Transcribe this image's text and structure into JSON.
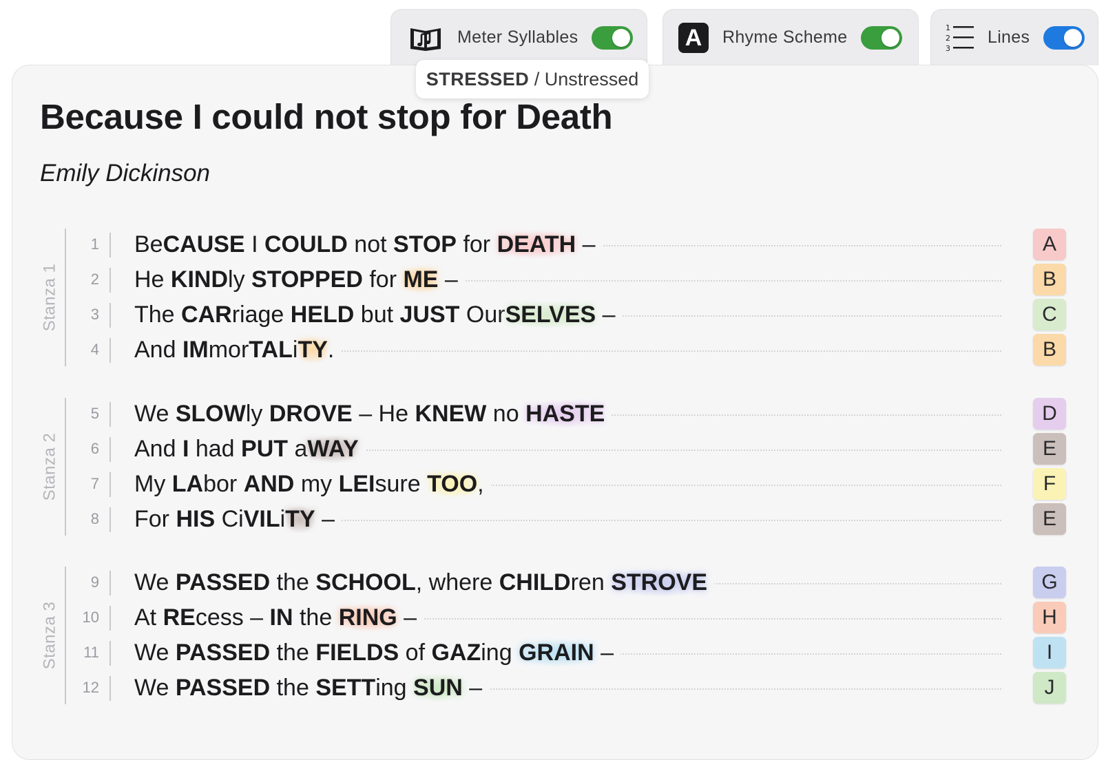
{
  "toolbar": {
    "meter": {
      "label": "Meter Syllables",
      "enabled": true,
      "toggle_color": "#3a9d3e",
      "icon": "music-book-icon"
    },
    "rhyme": {
      "label": "Rhyme Scheme",
      "enabled": true,
      "toggle_color": "#3a9d3e",
      "icon": "letter-a-icon",
      "icon_letter": "A"
    },
    "lines": {
      "label": "Lines",
      "enabled": true,
      "toggle_color": "#1f7ae0",
      "icon": "numbered-list-icon"
    }
  },
  "tooltip": {
    "stressed": "STRESSED",
    "separator": " / ",
    "unstressed": "Unstressed"
  },
  "poem": {
    "title": "Because I could not stop for Death",
    "author": "Emily Dickinson"
  },
  "rhyme_colors": {
    "A": "#f8c9c9",
    "B": "#fbd9a8",
    "C": "#d8ebcd",
    "D": "#e5cdee",
    "E": "#cbbfbb",
    "F": "#fbf3b5",
    "G": "#c9cdee",
    "H": "#f9cbb8",
    "I": "#bfe2f3",
    "J": "#cfe8c6"
  },
  "stanzas": [
    {
      "label": "Stanza 1",
      "lines": [
        {
          "num": "1",
          "rhyme": "A",
          "segments": [
            [
              "Be",
              0
            ],
            [
              "CAUSE",
              1
            ],
            [
              " I ",
              0
            ],
            [
              "COULD",
              1
            ],
            [
              " not ",
              0
            ],
            [
              "STOP",
              1
            ],
            [
              " for ",
              0
            ],
            [
              "DEATH",
              1
            ],
            [
              " –",
              0
            ]
          ]
        },
        {
          "num": "2",
          "rhyme": "B",
          "segments": [
            [
              "He ",
              0
            ],
            [
              "KIND",
              1
            ],
            [
              "ly ",
              0
            ],
            [
              "STOPPED",
              1
            ],
            [
              " for ",
              0
            ],
            [
              "ME",
              1
            ],
            [
              " –",
              0
            ]
          ]
        },
        {
          "num": "3",
          "rhyme": "C",
          "segments": [
            [
              "The ",
              0
            ],
            [
              "CAR",
              1
            ],
            [
              "riage ",
              0
            ],
            [
              "HELD",
              1
            ],
            [
              " but ",
              0
            ],
            [
              "JUST",
              1
            ],
            [
              " Our",
              0
            ],
            [
              "SELVES",
              1
            ],
            [
              " –",
              0
            ]
          ]
        },
        {
          "num": "4",
          "rhyme": "B",
          "segments": [
            [
              "And ",
              0
            ],
            [
              "IM",
              1
            ],
            [
              "mor",
              0
            ],
            [
              "TAL",
              1
            ],
            [
              "i",
              0
            ],
            [
              "TY",
              1
            ],
            [
              ".",
              0
            ]
          ]
        }
      ]
    },
    {
      "label": "Stanza 2",
      "lines": [
        {
          "num": "5",
          "rhyme": "D",
          "segments": [
            [
              "We ",
              0
            ],
            [
              "SLOW",
              1
            ],
            [
              "ly ",
              0
            ],
            [
              "DROVE",
              1
            ],
            [
              " – He ",
              0
            ],
            [
              "KNEW",
              1
            ],
            [
              " no ",
              0
            ],
            [
              "HASTE",
              1
            ]
          ]
        },
        {
          "num": "6",
          "rhyme": "E",
          "segments": [
            [
              "And ",
              0
            ],
            [
              "I",
              1
            ],
            [
              " had ",
              0
            ],
            [
              "PUT",
              1
            ],
            [
              " a",
              0
            ],
            [
              "WAY",
              1
            ]
          ]
        },
        {
          "num": "7",
          "rhyme": "F",
          "segments": [
            [
              "My ",
              0
            ],
            [
              "LA",
              1
            ],
            [
              "bor ",
              0
            ],
            [
              "AND",
              1
            ],
            [
              " my ",
              0
            ],
            [
              "LEI",
              1
            ],
            [
              "sure ",
              0
            ],
            [
              "TOO",
              1
            ],
            [
              ",",
              0
            ]
          ]
        },
        {
          "num": "8",
          "rhyme": "E",
          "segments": [
            [
              "For ",
              0
            ],
            [
              "HIS",
              1
            ],
            [
              " Ci",
              0
            ],
            [
              "VIL",
              1
            ],
            [
              "i",
              0
            ],
            [
              "TY",
              1
            ],
            [
              " –",
              0
            ]
          ]
        }
      ]
    },
    {
      "label": "Stanza 3",
      "lines": [
        {
          "num": "9",
          "rhyme": "G",
          "segments": [
            [
              "We ",
              0
            ],
            [
              "PASSED",
              1
            ],
            [
              " the ",
              0
            ],
            [
              "SCHOOL",
              1
            ],
            [
              ", where ",
              0
            ],
            [
              "CHILD",
              1
            ],
            [
              "ren ",
              0
            ],
            [
              "STROVE",
              1
            ]
          ]
        },
        {
          "num": "10",
          "rhyme": "H",
          "segments": [
            [
              "At ",
              0
            ],
            [
              "RE",
              1
            ],
            [
              "cess – ",
              0
            ],
            [
              "IN",
              1
            ],
            [
              " the ",
              0
            ],
            [
              "RING",
              1
            ],
            [
              " –",
              0
            ]
          ]
        },
        {
          "num": "11",
          "rhyme": "I",
          "segments": [
            [
              "We ",
              0
            ],
            [
              "PASSED",
              1
            ],
            [
              " the ",
              0
            ],
            [
              "FIELDS",
              1
            ],
            [
              " of ",
              0
            ],
            [
              "GAZ",
              1
            ],
            [
              "ing ",
              0
            ],
            [
              "GRAIN",
              1
            ],
            [
              " –",
              0
            ]
          ]
        },
        {
          "num": "12",
          "rhyme": "J",
          "segments": [
            [
              "We ",
              0
            ],
            [
              "PASSED",
              1
            ],
            [
              " the ",
              0
            ],
            [
              "SETT",
              1
            ],
            [
              "ing ",
              0
            ],
            [
              "SUN",
              1
            ],
            [
              " –",
              0
            ]
          ]
        }
      ]
    }
  ]
}
